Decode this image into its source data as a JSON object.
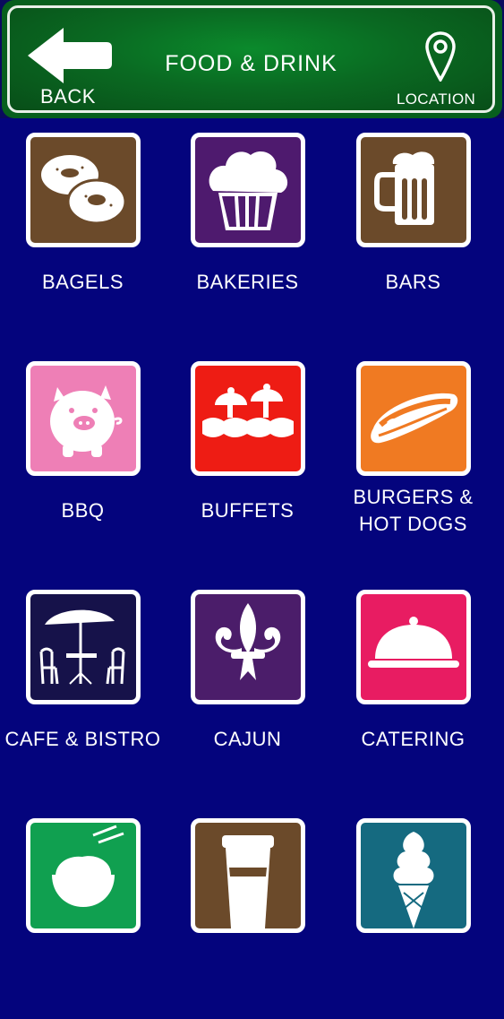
{
  "header": {
    "title": "FOOD & DRINK",
    "back_label": "BACK",
    "location_label": "LOCATION"
  },
  "categories": [
    {
      "label": "BAGELS",
      "icon": "bagels-icon",
      "color": "#6b4a2a"
    },
    {
      "label": "BAKERIES",
      "icon": "muffin-icon",
      "color": "#4e1a6e"
    },
    {
      "label": "BARS",
      "icon": "beer-mug-icon",
      "color": "#6b4a2a"
    },
    {
      "label": "BBQ",
      "icon": "pig-icon",
      "color": "#ee7fb6"
    },
    {
      "label": "BUFFETS",
      "icon": "buffet-icon",
      "color": "#ee1c14"
    },
    {
      "label": "BURGERS & HOT DOGS",
      "label_line1": "BURGERS &",
      "label_line2": "HOT DOGS",
      "icon": "hot-dog-icon",
      "color": "#f07a22"
    },
    {
      "label": "CAFE & BISTRO",
      "icon": "cafe-table-icon",
      "color": "#16124a"
    },
    {
      "label": "CAJUN",
      "icon": "fleur-de-lis-icon",
      "color": "#4b1d6a"
    },
    {
      "label": "CATERING",
      "icon": "cloche-icon",
      "color": "#e81c62"
    },
    {
      "label": "",
      "icon": "rice-bowl-icon",
      "color": "#10a050"
    },
    {
      "label": "",
      "icon": "coffee-cup-icon",
      "color": "#6b4a2a"
    },
    {
      "label": "",
      "icon": "ice-cream-icon",
      "color": "#156a80"
    }
  ]
}
